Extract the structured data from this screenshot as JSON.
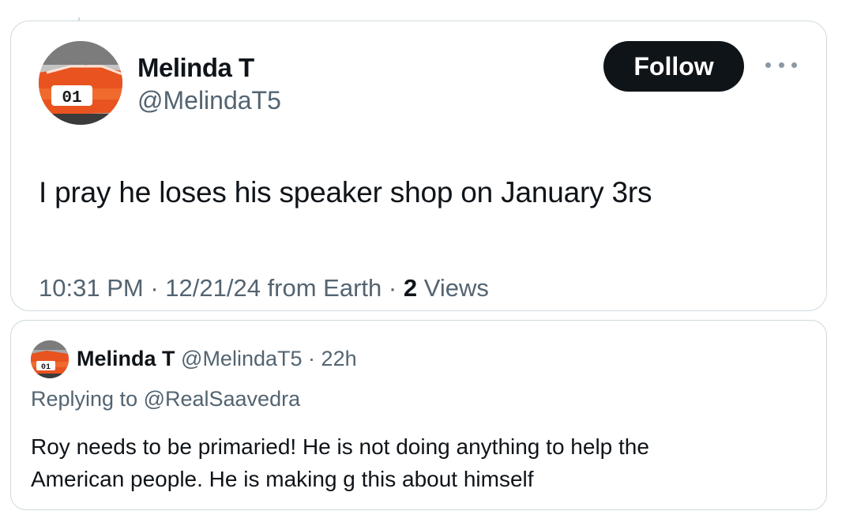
{
  "tweet": {
    "display_name": "Melinda T",
    "handle": "@MelindaT5",
    "follow_label": "Follow",
    "more_icon": "more-horizontal-icon",
    "avatar_badge": "01",
    "text": "I pray he loses his speaker shop on January 3rs",
    "time": "10:31 PM",
    "date": "12/21/24",
    "source": "from Earth",
    "views_count": "2",
    "views_label": "Views"
  },
  "quote": {
    "display_name": "Melinda T",
    "handle": "@MelindaT5",
    "age": "22h",
    "avatar_badge": "01",
    "replying_to": "Replying to @RealSaavedra",
    "text_line1": "Roy needs to be primaried! He is not doing anything to help the",
    "text_line2": "American people. He is making g this about himself"
  },
  "colors": {
    "text": "#0f1419",
    "secondary": "#536471",
    "border": "#cfd9de",
    "button_bg": "#0f1419",
    "avatar_car": "#e8531f"
  }
}
